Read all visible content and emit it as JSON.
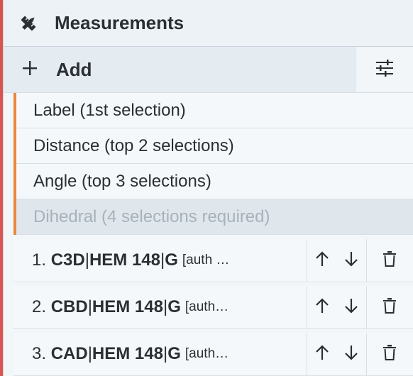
{
  "header": {
    "title": "Measurements",
    "icon": "ruler-pencil-icon"
  },
  "toolbar": {
    "add_label": "Add",
    "add_icon": "plus-icon",
    "options_icon": "sliders-icon"
  },
  "add_menu": [
    {
      "label": "Label (1st selection)",
      "enabled": true
    },
    {
      "label": "Distance (top 2 selections)",
      "enabled": true
    },
    {
      "label": "Angle (top 3 selections)",
      "enabled": true
    },
    {
      "label": "Dihedral (4 selections required)",
      "enabled": false
    }
  ],
  "measurements": [
    {
      "index": "1.",
      "atom": "C3D",
      "residue": "HEM 148",
      "chain": "G",
      "extra": "[auth …"
    },
    {
      "index": "2.",
      "atom": "CBD",
      "residue": "HEM 148",
      "chain": "G",
      "extra": "[auth…"
    },
    {
      "index": "3.",
      "atom": "CAD",
      "residue": "HEM 148",
      "chain": "G",
      "extra": "[auth…"
    }
  ],
  "separator": " | ",
  "colors": {
    "menu_accent": "#e8883a",
    "left_edge": "#d9534f"
  }
}
